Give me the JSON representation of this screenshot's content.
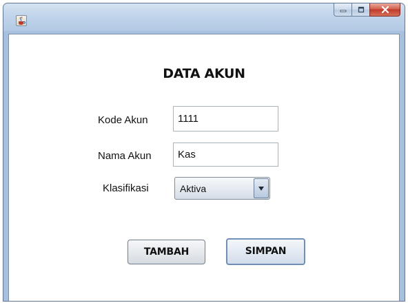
{
  "window": {
    "icon": "java-cup-icon"
  },
  "form": {
    "title": "DATA AKUN",
    "kode_akun": {
      "label": "Kode Akun",
      "value": "1111"
    },
    "nama_akun": {
      "label": "Nama Akun",
      "value": "Kas"
    },
    "klasifikasi": {
      "label": "Klasifikasi",
      "value": "Aktiva"
    }
  },
  "buttons": {
    "tambah": "TAMBAH",
    "simpan": "SIMPAN"
  },
  "colors": {
    "title_bar": "#b9cfe8",
    "close_button": "#c0392b",
    "focus_border": "#6f8fb8"
  }
}
